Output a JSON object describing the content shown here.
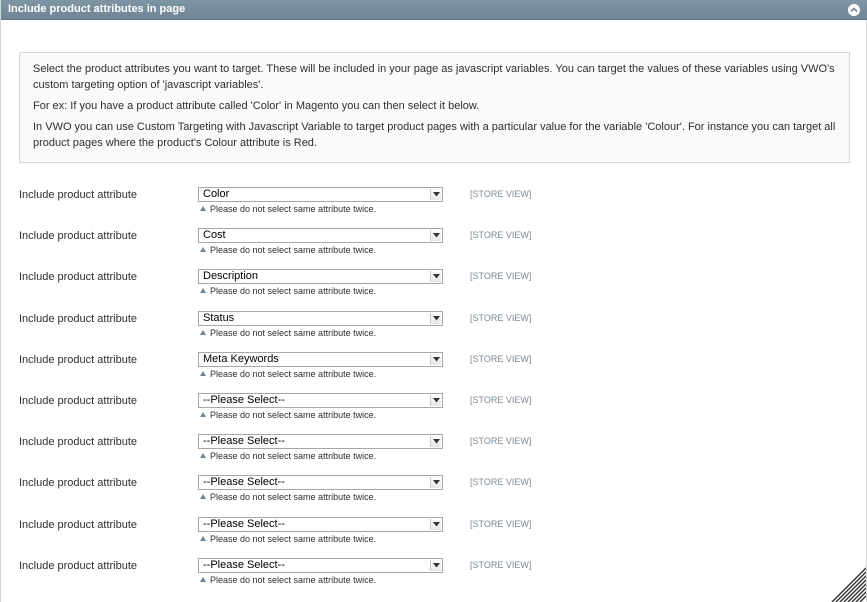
{
  "header": {
    "title": "Include product attributes in page"
  },
  "notice": {
    "p1": "Select the product attributes you want to target. These will be included in your page as javascript variables. You can target the values of these variables using VWO's custom targeting option of 'javascript variables'.",
    "p2": "For ex: If you have a product attribute called 'Color' in Magento you can then select it below.",
    "p3": "In VWO you can use Custom Targeting with Javascript Variable to target product pages with a particular value for the variable 'Colour'. For instance you can target all product pages where the product's Colour attribute is Red."
  },
  "rows": [
    {
      "label": "Include product attribute",
      "value": "Color",
      "hint": "Please do not select same attribute twice.",
      "scope": "[STORE VIEW]"
    },
    {
      "label": "Include product attribute",
      "value": "Cost",
      "hint": "Please do not select same attribute twice.",
      "scope": "[STORE VIEW]"
    },
    {
      "label": "Include product attribute",
      "value": "Description",
      "hint": "Please do not select same attribute twice.",
      "scope": "[STORE VIEW]"
    },
    {
      "label": "Include product attribute",
      "value": "Status",
      "hint": "Please do not select same attribute twice.",
      "scope": "[STORE VIEW]"
    },
    {
      "label": "Include product attribute",
      "value": "Meta Keywords",
      "hint": "Please do not select same attribute twice.",
      "scope": "[STORE VIEW]"
    },
    {
      "label": "Include product attribute",
      "value": "--Please Select--",
      "hint": "Please do not select same attribute twice.",
      "scope": "[STORE VIEW]"
    },
    {
      "label": "Include product attribute",
      "value": "--Please Select--",
      "hint": "Please do not select same attribute twice.",
      "scope": "[STORE VIEW]"
    },
    {
      "label": "Include product attribute",
      "value": "--Please Select--",
      "hint": "Please do not select same attribute twice.",
      "scope": "[STORE VIEW]"
    },
    {
      "label": "Include product attribute",
      "value": "--Please Select--",
      "hint": "Please do not select same attribute twice.",
      "scope": "[STORE VIEW]"
    },
    {
      "label": "Include product attribute",
      "value": "--Please Select--",
      "hint": "Please do not select same attribute twice.",
      "scope": "[STORE VIEW]"
    }
  ],
  "icons": {
    "collapse": "chevron-up-icon",
    "select_arrow": "chevron-down-icon",
    "hint": "triangle-up-icon",
    "resize": "resize-grip-icon"
  },
  "colors": {
    "header_bg": "#7e95a6",
    "scope_text": "#7d8a96"
  }
}
